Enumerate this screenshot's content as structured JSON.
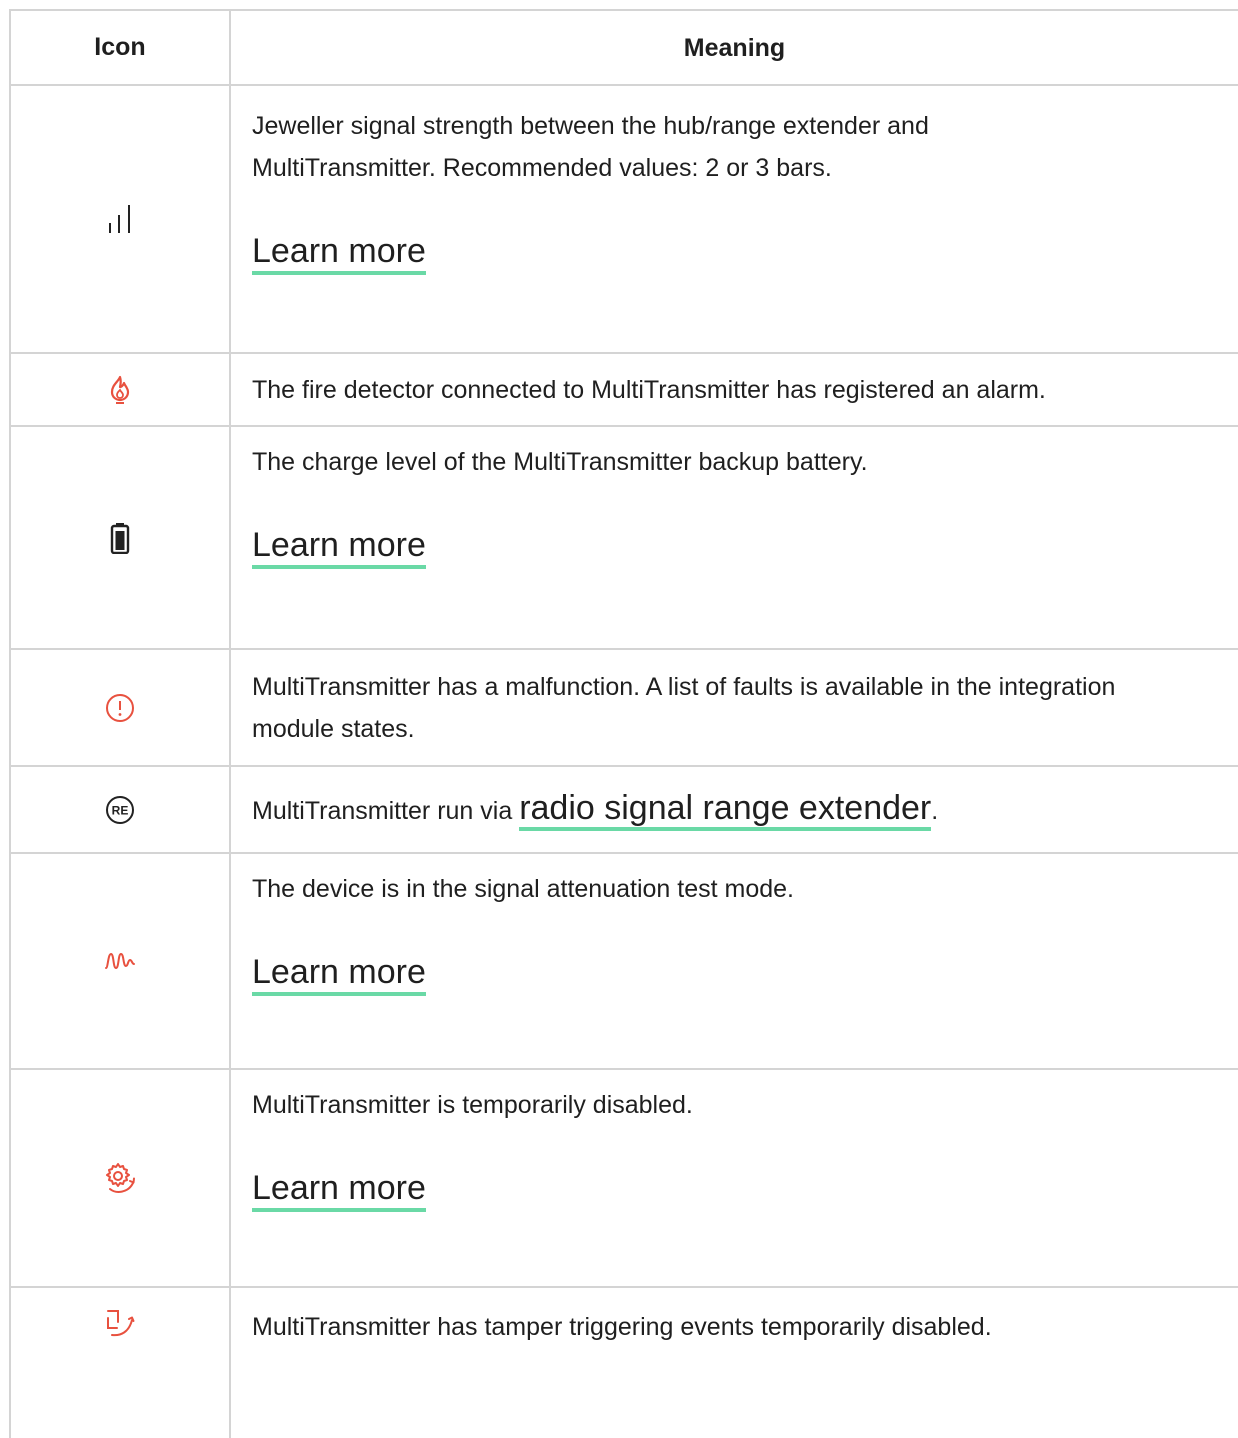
{
  "header": {
    "icon_col": "Icon",
    "meaning_col": "Meaning"
  },
  "rows": [
    {
      "icon": "signal-bars-icon",
      "text": "Jeweller signal strength between the hub/range extender and MultiTransmitter. Recommended values: 2 or 3 bars.",
      "link": "Learn more"
    },
    {
      "icon": "fire-alarm-icon",
      "text": "The fire detector connected to MultiTransmitter has registered an alarm."
    },
    {
      "icon": "battery-icon",
      "text": "The charge level of the MultiTransmitter backup battery.",
      "link": "Learn more"
    },
    {
      "icon": "malfunction-icon",
      "text": "MultiTransmitter has a malfunction. A list of faults is available in the integration module states."
    },
    {
      "icon": "range-extender-icon",
      "text_before": "MultiTransmitter run via ",
      "link": "radio signal range extender",
      "text_after": "."
    },
    {
      "icon": "attenuation-test-icon",
      "text": "The device is in the signal attenuation test mode.",
      "link": "Learn more"
    },
    {
      "icon": "temporarily-disabled-icon",
      "text": "MultiTransmitter is temporarily disabled.",
      "link": "Learn more"
    },
    {
      "icon": "tamper-disabled-icon",
      "text": "MultiTransmitter has tamper triggering events temporarily disabled."
    }
  ],
  "colors": {
    "accent_underline": "#6ad9a6",
    "alert_red": "#e8513f",
    "border": "#d4d4d4"
  }
}
